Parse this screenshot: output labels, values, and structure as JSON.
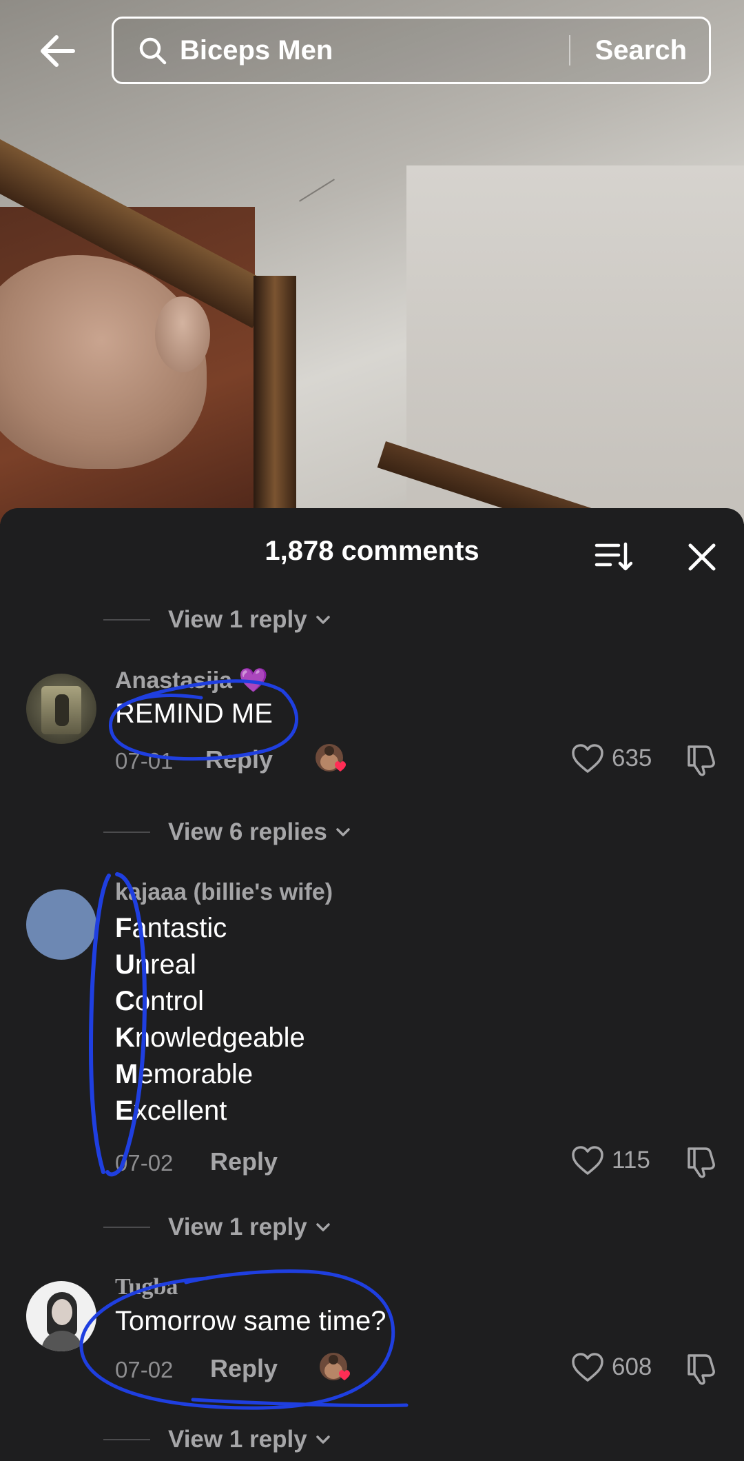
{
  "search": {
    "query": "Biceps Men",
    "button_label": "Search"
  },
  "comments_sheet": {
    "title": "1,878 comments"
  },
  "view_replies": [
    {
      "label": "View 1 reply"
    },
    {
      "label": "View 6 replies"
    },
    {
      "label": "View 1 reply"
    },
    {
      "label": "View 1 reply"
    }
  ],
  "comments": [
    {
      "username": "Anastasija 💜",
      "text": "REMIND ME",
      "date": "07-01",
      "reply_label": "Reply",
      "likes": "635"
    },
    {
      "username": "kajaaa (billie's wife)",
      "lines": [
        {
          "initial": "F",
          "rest": "antastic"
        },
        {
          "initial": "U",
          "rest": "nreal"
        },
        {
          "initial": "C",
          "rest": "ontrol"
        },
        {
          "initial": "K",
          "rest": "nowledgeable"
        },
        {
          "initial": "M",
          "rest": "emorable"
        },
        {
          "initial": "E",
          "rest": "xcellent"
        }
      ],
      "date": "07-02",
      "reply_label": "Reply",
      "likes": "115"
    },
    {
      "username": "Tugba",
      "text": "Tomorrow same time?",
      "date": "07-02",
      "reply_label": "Reply",
      "likes": "608"
    }
  ],
  "colors": {
    "sheet_bg": "#1e1e1f",
    "muted_text": "#a6a6a8",
    "annotation_ink": "#1f3fe0",
    "heart_sticker": "#ff2d55"
  },
  "icons": [
    "back-arrow-icon",
    "search-icon",
    "sort-icon",
    "close-icon",
    "chevron-down-icon",
    "heart-icon",
    "dislike-icon"
  ]
}
